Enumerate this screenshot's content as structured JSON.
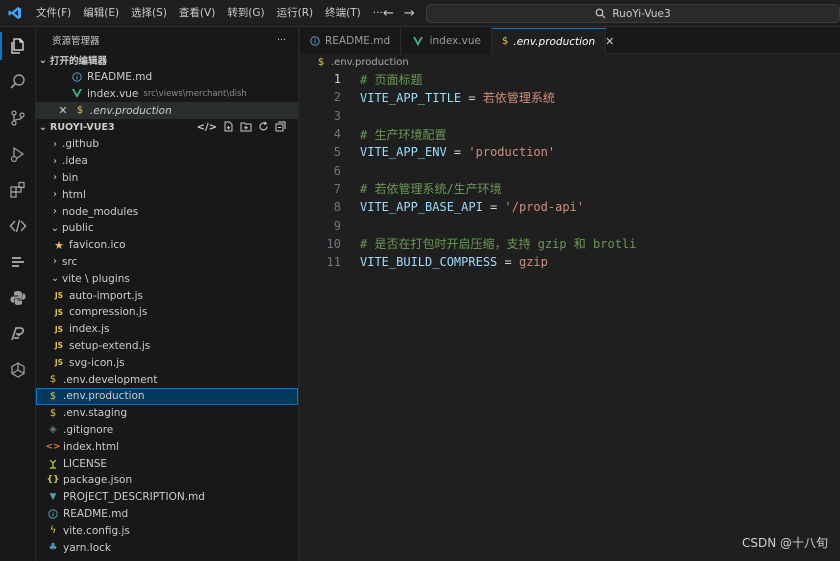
{
  "menu": [
    "文件(F)",
    "编辑(E)",
    "选择(S)",
    "查看(V)",
    "转到(G)",
    "运行(R)",
    "终端(T)",
    "···"
  ],
  "search": {
    "text": "RuoYi-Vue3"
  },
  "sidebar": {
    "title": "资源管理器",
    "more": "···",
    "open_editors": {
      "label": "打开的编辑器",
      "items": [
        {
          "name": "README.md",
          "desc": ""
        },
        {
          "name": "index.vue",
          "desc": "src\\views\\merchant\\dish"
        },
        {
          "name": ".env.production",
          "desc": ""
        }
      ]
    },
    "project": {
      "label": "RUOYI-VUE3",
      "items": [
        {
          "name": ".github"
        },
        {
          "name": ".idea"
        },
        {
          "name": "bin"
        },
        {
          "name": "html"
        },
        {
          "name": "node_modules"
        },
        {
          "name": "public"
        },
        {
          "name": "favicon.ico"
        },
        {
          "name": "src"
        },
        {
          "name": "vite \\ plugins"
        },
        {
          "name": "auto-import.js"
        },
        {
          "name": "compression.js"
        },
        {
          "name": "index.js"
        },
        {
          "name": "setup-extend.js"
        },
        {
          "name": "svg-icon.js"
        },
        {
          "name": ".env.development"
        },
        {
          "name": ".env.production"
        },
        {
          "name": ".env.staging"
        },
        {
          "name": ".gitignore"
        },
        {
          "name": "index.html"
        },
        {
          "name": "LICENSE"
        },
        {
          "name": "package.json"
        },
        {
          "name": "PROJECT_DESCRIPTION.md"
        },
        {
          "name": "README.md"
        },
        {
          "name": "vite.config.js"
        },
        {
          "name": "yarn.lock"
        }
      ]
    }
  },
  "tabs": [
    "README.md",
    "index.vue",
    ".env.production"
  ],
  "breadcrumb": ".env.production",
  "code": {
    "line_numbers": [
      "1",
      "2",
      "3",
      "4",
      "5",
      "6",
      "7",
      "8",
      "9",
      "10",
      "11"
    ],
    "l1": "# 页面标题",
    "l2_key": "VITE_APP_TITLE",
    "l2_op": " = ",
    "l2_val": "若依管理系统",
    "l4": "# 生产环境配置",
    "l5_key": "VITE_APP_ENV",
    "l5_op": " = ",
    "l5_val": "'production'",
    "l7": "# 若依管理系统/生产环境",
    "l8_key": "VITE_APP_BASE_API",
    "l8_op": " = ",
    "l8_val": "'/prod-api'",
    "l10": "# 是否在打包时开启压缩，支持 gzip 和 brotli",
    "l11_key": "VITE_BUILD_COMPRESS",
    "l11_op": " = ",
    "l11_val": "gzip"
  },
  "watermark": "CSDN @十八旬",
  "colors": {
    "accent": "#0078d4",
    "vue": "#41b883",
    "env": "#e8c446",
    "js": "#e8c446"
  }
}
